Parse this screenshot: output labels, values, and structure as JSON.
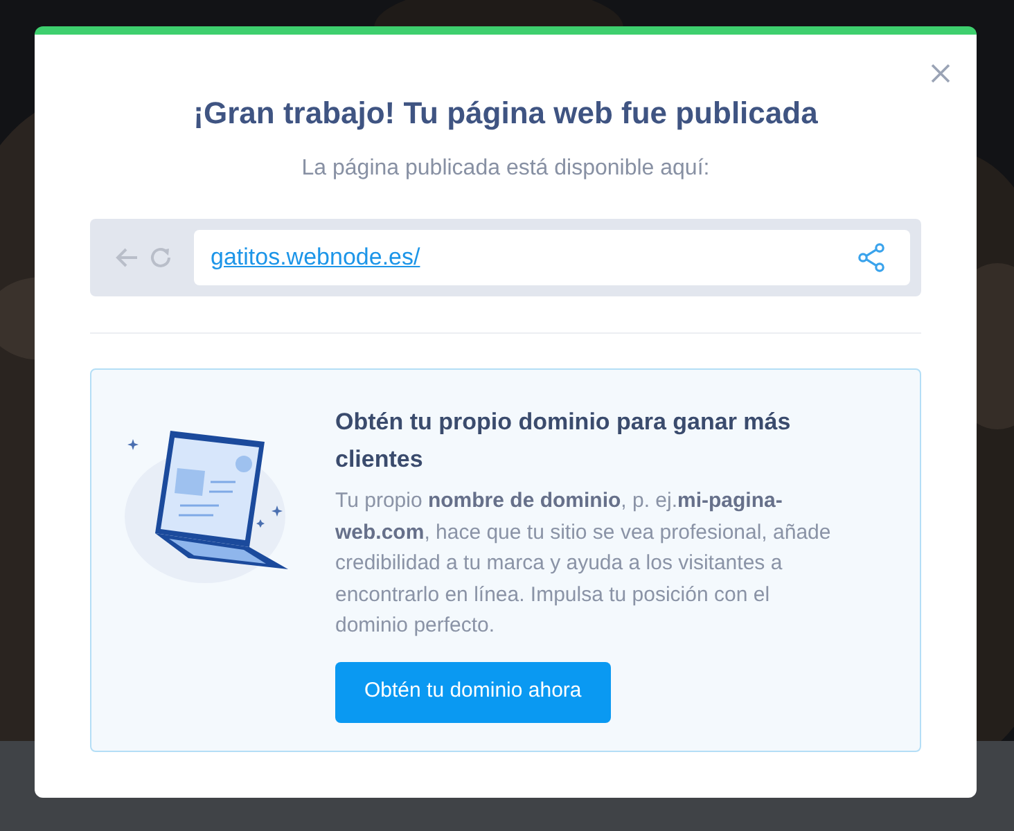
{
  "dialog": {
    "title": "¡Gran trabajo! Tu página web fue publicada",
    "subtitle": "La página publicada está disponible aquí:",
    "url": "gatitos.webnode.es/"
  },
  "promo": {
    "heading": "Obtén tu propio dominio para ganar más clientes",
    "body": "Tu propio **nombre de dominio**, p. ej.**mi-pagina-web.com**, hace que tu sitio se vea profesional, añade credibilidad a tu marca y ayuda a los visitantes a encontrarlo en línea. Impulsa tu posición con el dominio perfecto.",
    "button": "Obtén tu dominio ahora"
  }
}
